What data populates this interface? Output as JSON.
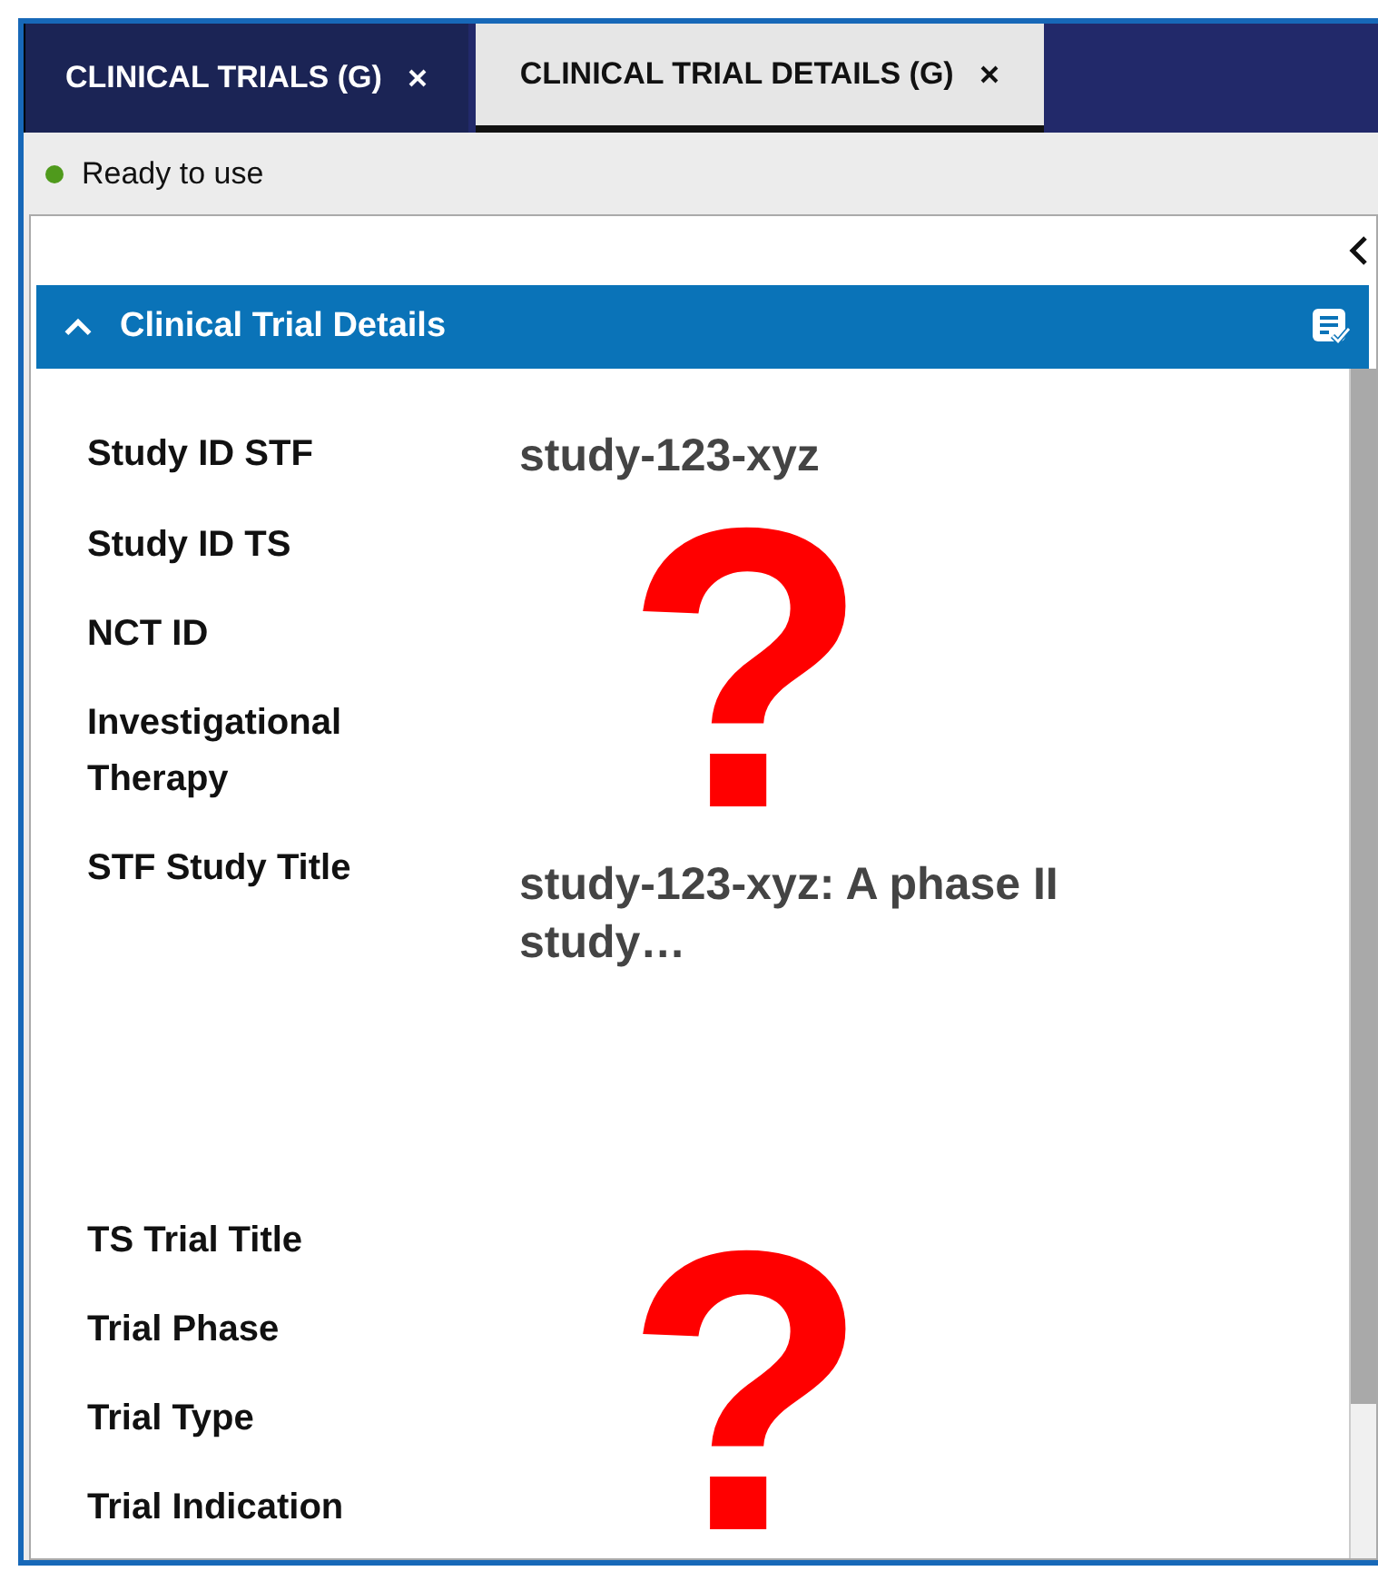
{
  "tabs": [
    {
      "label": "CLINICAL TRIALS (G)",
      "selected": false
    },
    {
      "label": "CLINICAL TRIAL DETAILS (G)",
      "selected": true
    }
  ],
  "status": {
    "text": "Ready to use"
  },
  "section": {
    "title": "Clinical Trial Details",
    "expanded": true
  },
  "fields": [
    {
      "label": "Study ID STF",
      "value": "study-123-xyz",
      "kind": "short"
    },
    {
      "label": "Study ID TS",
      "kind": "short"
    },
    {
      "label": "NCT ID",
      "kind": "short"
    },
    {
      "label": "Investigational Therapy",
      "kind": "short"
    },
    {
      "label": "STF Study Title",
      "value": "study-123-xyz: A phase II study…",
      "kind": "long"
    },
    {
      "label": "TS Trial Title",
      "kind": "short"
    },
    {
      "label": "Trial Phase",
      "kind": "short"
    },
    {
      "label": "Trial Type",
      "kind": "short"
    },
    {
      "label": "Trial Indication",
      "kind": "short"
    }
  ],
  "overlays": [
    {
      "text": "?"
    },
    {
      "text": "?"
    }
  ]
}
